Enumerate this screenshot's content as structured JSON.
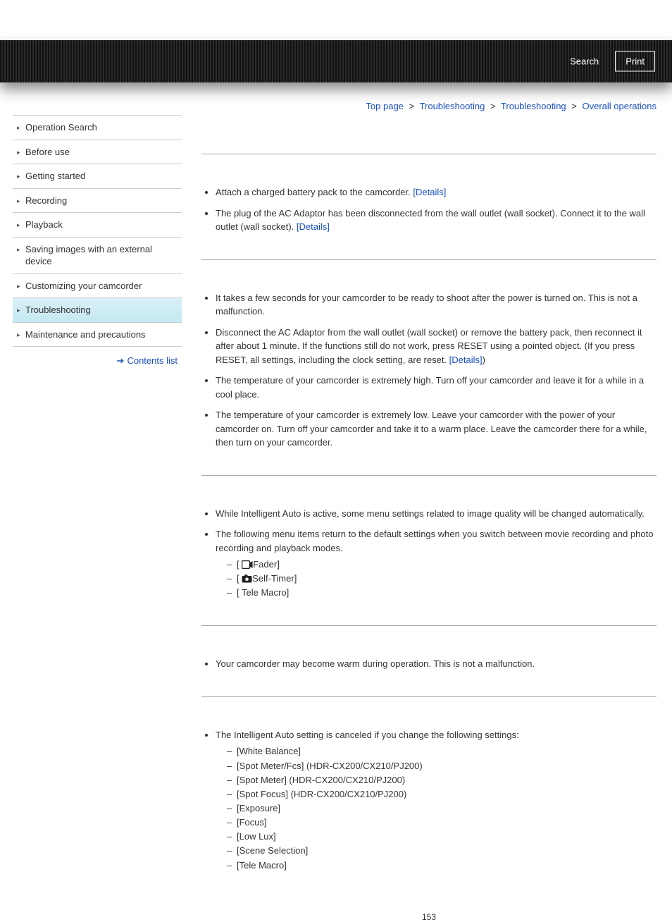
{
  "header": {
    "search_label": "Search",
    "print_label": "Print"
  },
  "sidebar": {
    "items": [
      "Operation Search",
      "Before use",
      "Getting started",
      "Recording",
      "Playback",
      "Saving images with an external device",
      "Customizing your camcorder",
      "Troubleshooting",
      "Maintenance and precautions"
    ],
    "active_index": 7,
    "contents_list_label": "Contents list"
  },
  "breadcrumb": {
    "items": [
      "Top page",
      "Troubleshooting",
      "Troubleshooting",
      "Overall operations"
    ],
    "sep": ">"
  },
  "sections": {
    "s1": {
      "b1_a": "Attach a charged battery pack to the camcorder. ",
      "b1_link": "[Details]",
      "b2_a": "The plug of the AC Adaptor has been disconnected from the wall outlet (wall socket). Connect it to the wall outlet (wall socket). ",
      "b2_link": "[Details]"
    },
    "s2": {
      "b1": "It takes a few seconds for your camcorder to be ready to shoot after the power is turned on. This is not a malfunction.",
      "b2_a": "Disconnect the AC Adaptor from the wall outlet (wall socket) or remove the battery pack, then reconnect it after about 1 minute. If the functions still do not work, press RESET using a pointed object. (If you press RESET, all settings, including the clock setting, are reset. ",
      "b2_link": "[Details]",
      "b2_b": ")",
      "b3": "The temperature of your camcorder is extremely high. Turn off your camcorder and leave it for a while in a cool place.",
      "b4": "The temperature of your camcorder is extremely low. Leave your camcorder with the power of your camcorder on. Turn off your camcorder and take it to a warm place. Leave the camcorder there for a while, then turn on your camcorder."
    },
    "s3": {
      "b1": "While Intelligent Auto is active, some menu settings related to image quality will be changed automatically.",
      "b2": "The following menu items return to the default settings when you switch between movie recording and photo recording and playback modes.",
      "sub": {
        "a_label": "Fader]",
        "a_prefix": "[ ",
        "b_label": "Self-Timer]",
        "b_prefix": "[ ",
        "c": "[ Tele Macro]"
      }
    },
    "s4": {
      "b1": "Your camcorder may become warm during operation. This is not a malfunction."
    },
    "s5": {
      "b1": "The Intelligent Auto setting is canceled if you change the following settings:",
      "sub": [
        "[White Balance]",
        "[Spot Meter/Fcs] (HDR-CX200/CX210/PJ200)",
        "[Spot Meter] (HDR-CX200/CX210/PJ200)",
        "[Spot Focus] (HDR-CX200/CX210/PJ200)",
        "[Exposure]",
        "[Focus]",
        "[Low Lux]",
        "[Scene Selection]",
        "[Tele Macro]"
      ]
    }
  },
  "page_number": "153"
}
